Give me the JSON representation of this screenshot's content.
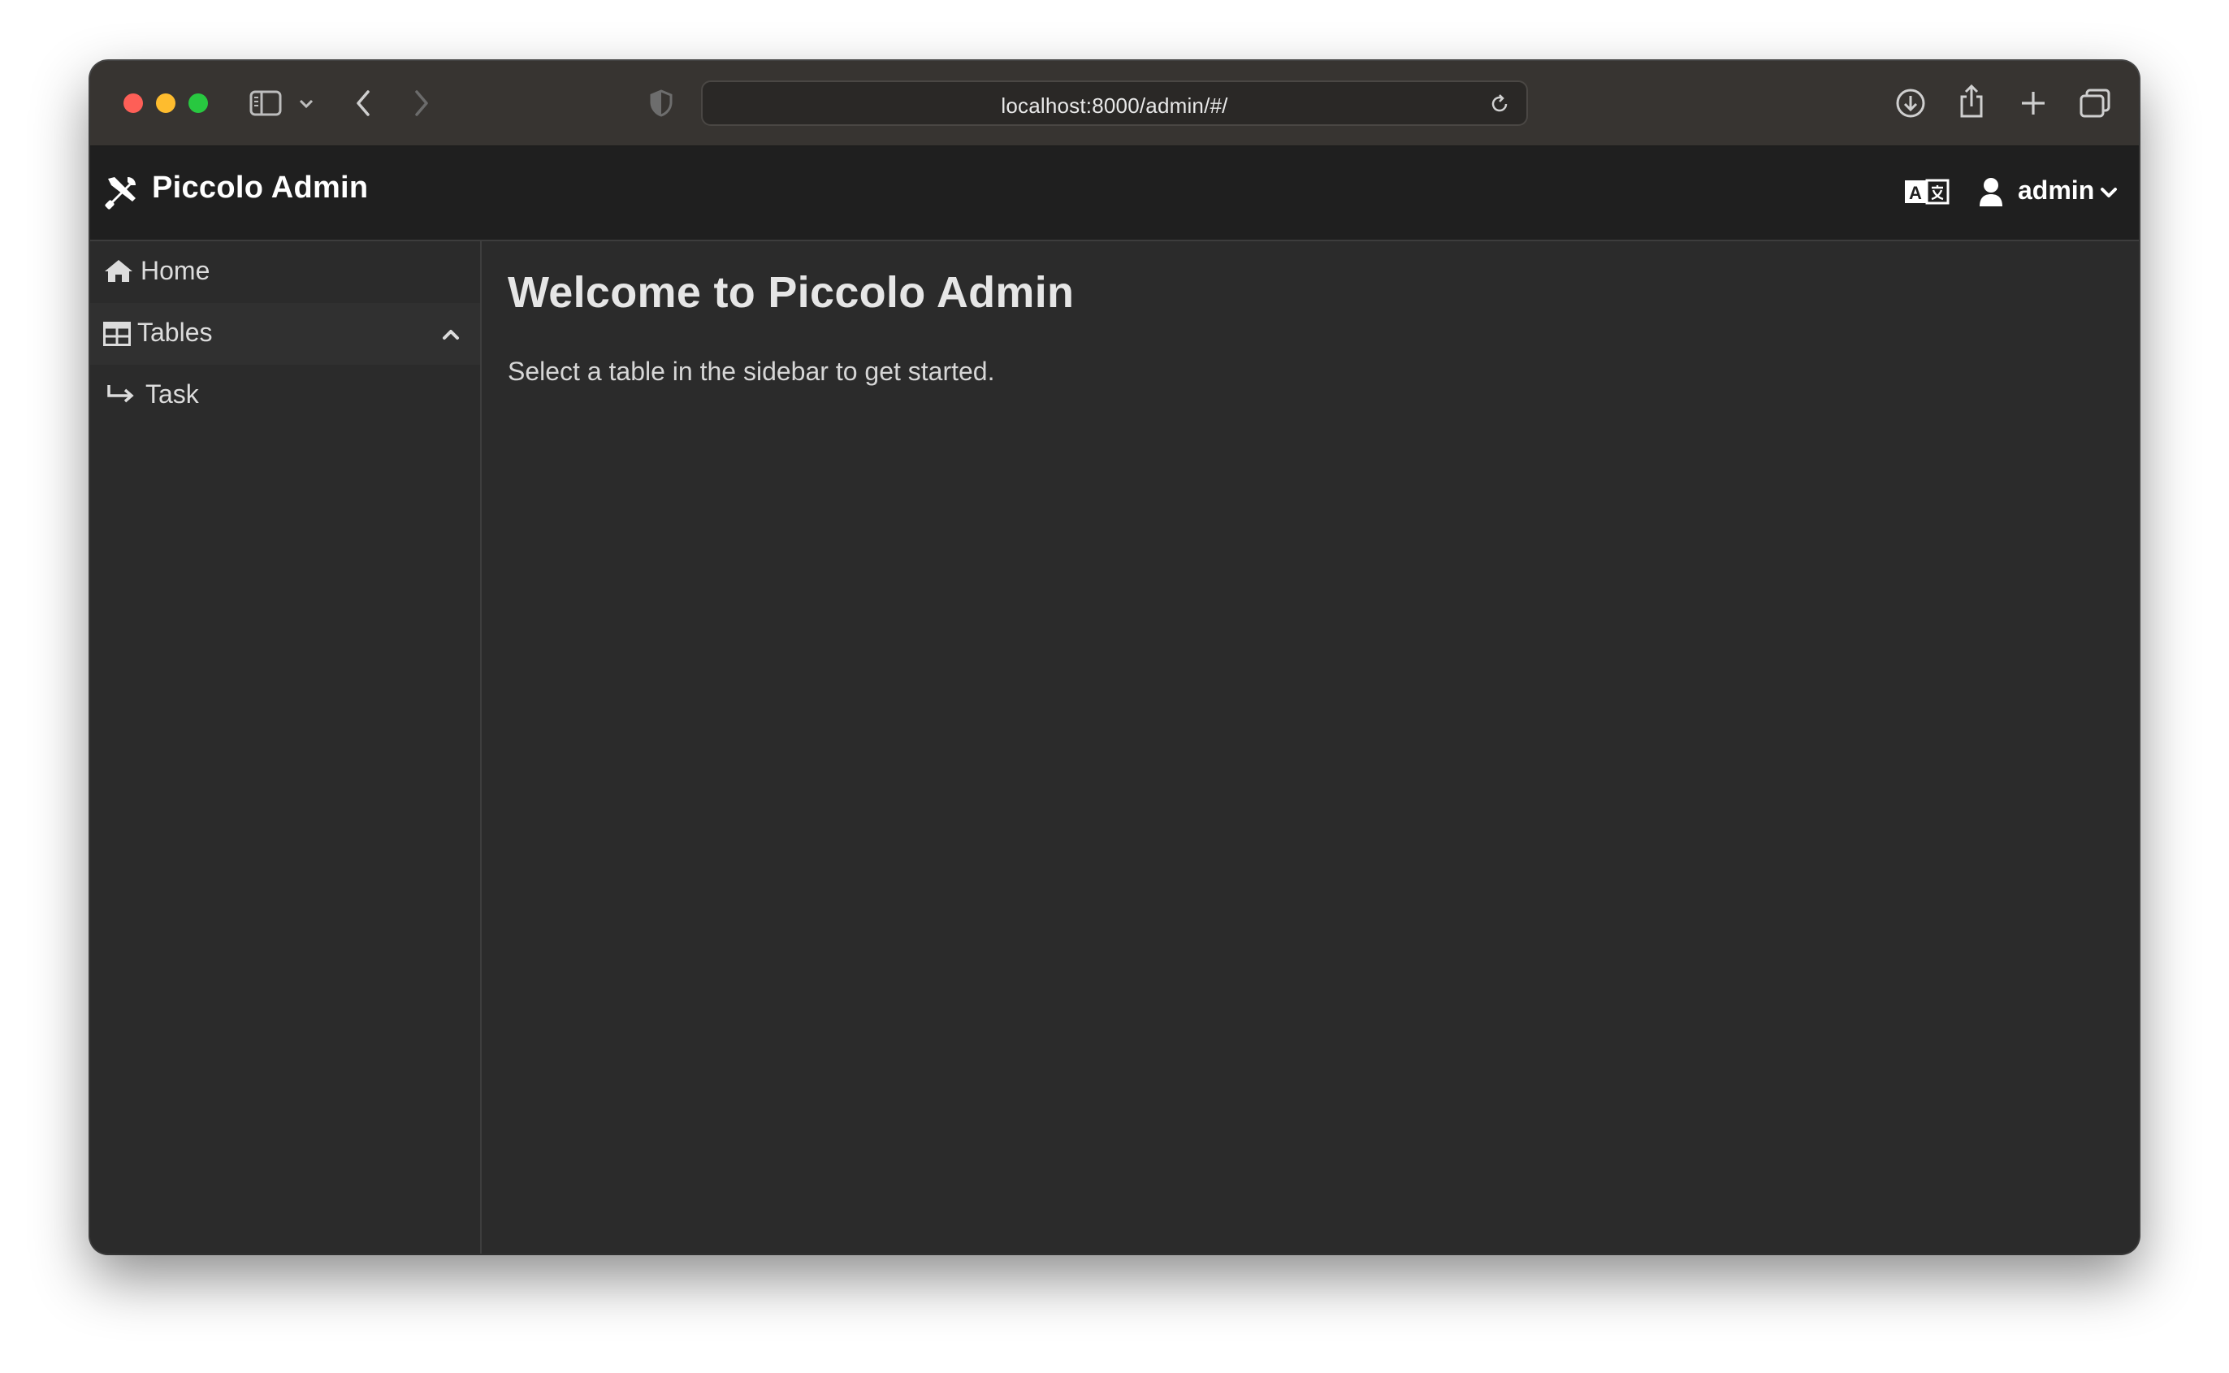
{
  "browser": {
    "url": "localhost:8000/admin/#/"
  },
  "header": {
    "app_title": "Piccolo Admin",
    "user_label": "admin"
  },
  "sidebar": {
    "items": [
      {
        "label": "Home",
        "icon": "home-icon"
      },
      {
        "label": "Tables",
        "icon": "table-icon",
        "expanded": true
      },
      {
        "label": "Task",
        "icon": "arrow-return-icon"
      }
    ]
  },
  "main": {
    "title": "Welcome to Piccolo Admin",
    "subtitle": "Select a table in the sidebar to get started."
  }
}
